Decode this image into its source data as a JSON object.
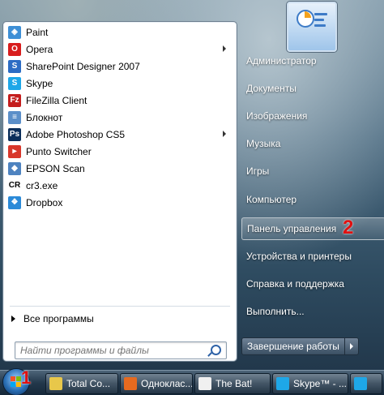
{
  "programs": [
    {
      "label": "Paint",
      "icon": "paint-icon",
      "color": "#3d8fd6",
      "glyph": "◈",
      "has_submenu": false
    },
    {
      "label": "Opera",
      "icon": "opera-icon",
      "color": "#d81d1d",
      "glyph": "O",
      "has_submenu": true
    },
    {
      "label": "SharePoint Designer 2007",
      "icon": "sharepoint-icon",
      "color": "#2c6cc4",
      "glyph": "S",
      "has_submenu": false
    },
    {
      "label": "Skype",
      "icon": "skype-icon",
      "color": "#1ea7e8",
      "glyph": "S",
      "has_submenu": false
    },
    {
      "label": "FileZilla Client",
      "icon": "filezilla-icon",
      "color": "#c41e1e",
      "glyph": "Fz",
      "has_submenu": false
    },
    {
      "label": "Блокнот",
      "icon": "notepad-icon",
      "color": "#5b8fc9",
      "glyph": "≡",
      "has_submenu": false
    },
    {
      "label": "Adobe Photoshop CS5",
      "icon": "photoshop-icon",
      "color": "#0b2f5b",
      "glyph": "Ps",
      "has_submenu": true
    },
    {
      "label": "Punto Switcher",
      "icon": "punto-switcher-icon",
      "color": "#d8372b",
      "glyph": "▸",
      "has_submenu": false
    },
    {
      "label": "EPSON Scan",
      "icon": "epson-scan-icon",
      "color": "#4e83c0",
      "glyph": "◆",
      "has_submenu": false
    },
    {
      "label": "cr3.exe",
      "icon": "cr3-icon",
      "color": "#ffffff",
      "glyph": "CR",
      "has_submenu": false
    },
    {
      "label": "Dropbox",
      "icon": "dropbox-icon",
      "color": "#2b8ad8",
      "glyph": "❖",
      "has_submenu": false
    }
  ],
  "all_programs_label": "Все программы",
  "search": {
    "placeholder": "Найти программы и файлы"
  },
  "right_links": [
    {
      "label": "Администратор"
    },
    {
      "label": "Документы"
    },
    {
      "label": "Изображения"
    },
    {
      "label": "Музыка"
    },
    {
      "label": "Игры"
    },
    {
      "label": "Компьютер"
    },
    {
      "label": "Панель управления",
      "highlighted": true
    },
    {
      "label": "Устройства и принтеры"
    },
    {
      "label": "Справка и поддержка"
    },
    {
      "label": "Выполнить..."
    }
  ],
  "shutdown_label": "Завершение работы",
  "markers": {
    "start": "1",
    "control_panel": "2"
  },
  "taskbar": [
    {
      "label": "Total Co...",
      "icon": "total-commander-icon",
      "color": "#e8c74a"
    },
    {
      "label": "Одноклас...",
      "icon": "firefox-icon",
      "color": "#e66a1f"
    },
    {
      "label": "The Bat!",
      "icon": "the-bat-icon",
      "color": "#f0f0f0"
    },
    {
      "label": "Skype™ - ...",
      "icon": "skype-icon",
      "color": "#1ea7e8"
    },
    {
      "label": "",
      "icon": "skype-icon",
      "color": "#1ea7e8"
    }
  ]
}
